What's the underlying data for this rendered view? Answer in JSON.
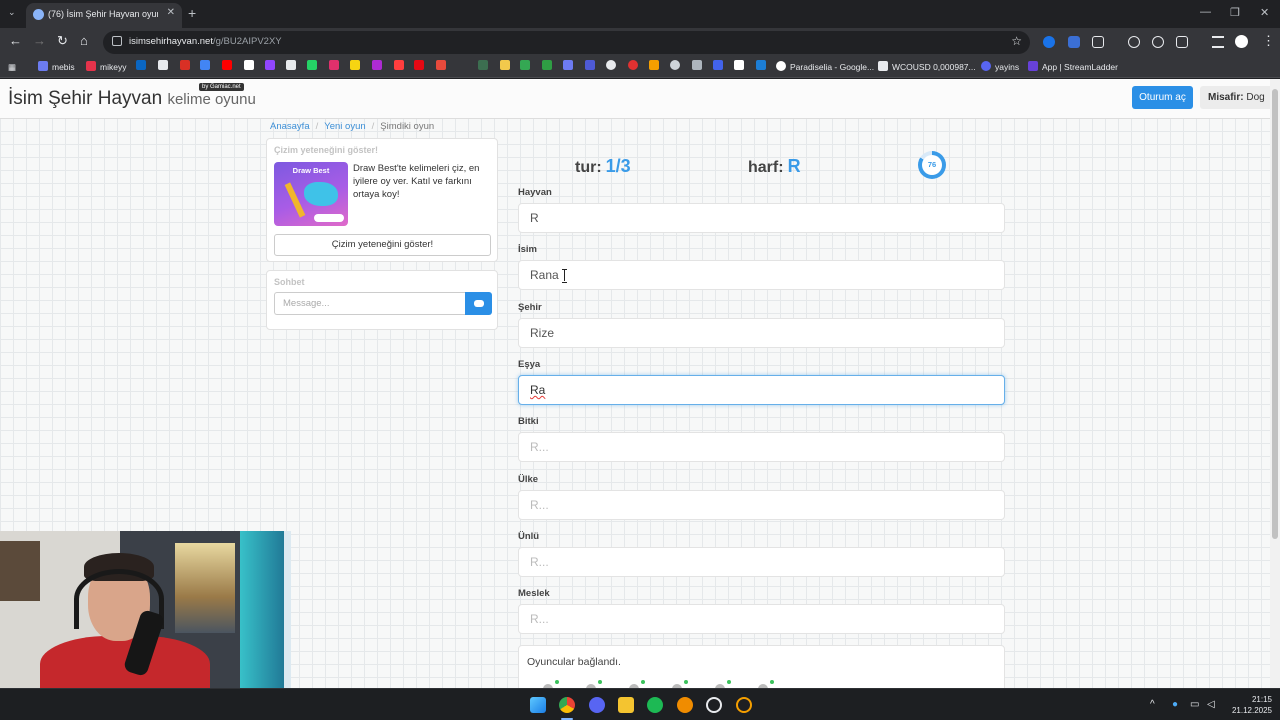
{
  "browser": {
    "tab_title": "(76) İsim Şehir Hayvan oyunu",
    "url_host": "isimsehirhayvan.net",
    "url_path": "/g/BU2AIPV2XY",
    "bookmarks": [
      "mebis",
      "mikeyy",
      "Paradiselia - Google...",
      "WCOUSD 0,000987...",
      "yayins",
      "App | StreamLadder"
    ]
  },
  "navbar": {
    "brand": "İsim Şehir Hayvan",
    "brand_sub": "kelime oyunu",
    "by_badge": "by Gamiac.net",
    "login_label": "Oturum aç",
    "guest_label": "Misafir:",
    "guest_name": "Dog"
  },
  "breadcrumb": {
    "home": "Anasayfa",
    "new_game": "Yeni oyun",
    "current": "Şimdiki oyun"
  },
  "promo": {
    "heading": "Çizim yeteneğini göster!",
    "image_title": "Draw Best",
    "text": "Draw Best'te kelimeleri çiz, en iyilere oy ver. Katıl ve farkını ortaya koy!",
    "button_label": "Çizim yeteneğini göster!"
  },
  "chat": {
    "heading": "Sohbet",
    "placeholder": "Message..."
  },
  "game": {
    "round_label": "tur:",
    "round_value": "1/3",
    "letter_label": "harf:",
    "letter_value": "R",
    "timer_value": "76",
    "timer_fraction": 0.84
  },
  "fields": [
    {
      "label": "Hayvan",
      "value": "R",
      "placeholder": "R..."
    },
    {
      "label": "İsim",
      "value": "Rana",
      "placeholder": "R..."
    },
    {
      "label": "Şehir",
      "value": "Rize",
      "placeholder": "R..."
    },
    {
      "label": "Eşya",
      "value": "Ra",
      "placeholder": "R..."
    },
    {
      "label": "Bitki",
      "value": "",
      "placeholder": "R..."
    },
    {
      "label": "Ülke",
      "value": "",
      "placeholder": "R..."
    },
    {
      "label": "Ünlü",
      "value": "",
      "placeholder": "R..."
    },
    {
      "label": "Meslek",
      "value": "",
      "placeholder": "R..."
    }
  ],
  "players": {
    "status_text": "Oyuncular bağlandı."
  },
  "taskbar": {
    "time": "21:15",
    "date": "21.12.2025"
  },
  "colors": {
    "accent": "#2b8fe6",
    "highlight": "#3a9be8",
    "chrome_bg": "#202124"
  }
}
